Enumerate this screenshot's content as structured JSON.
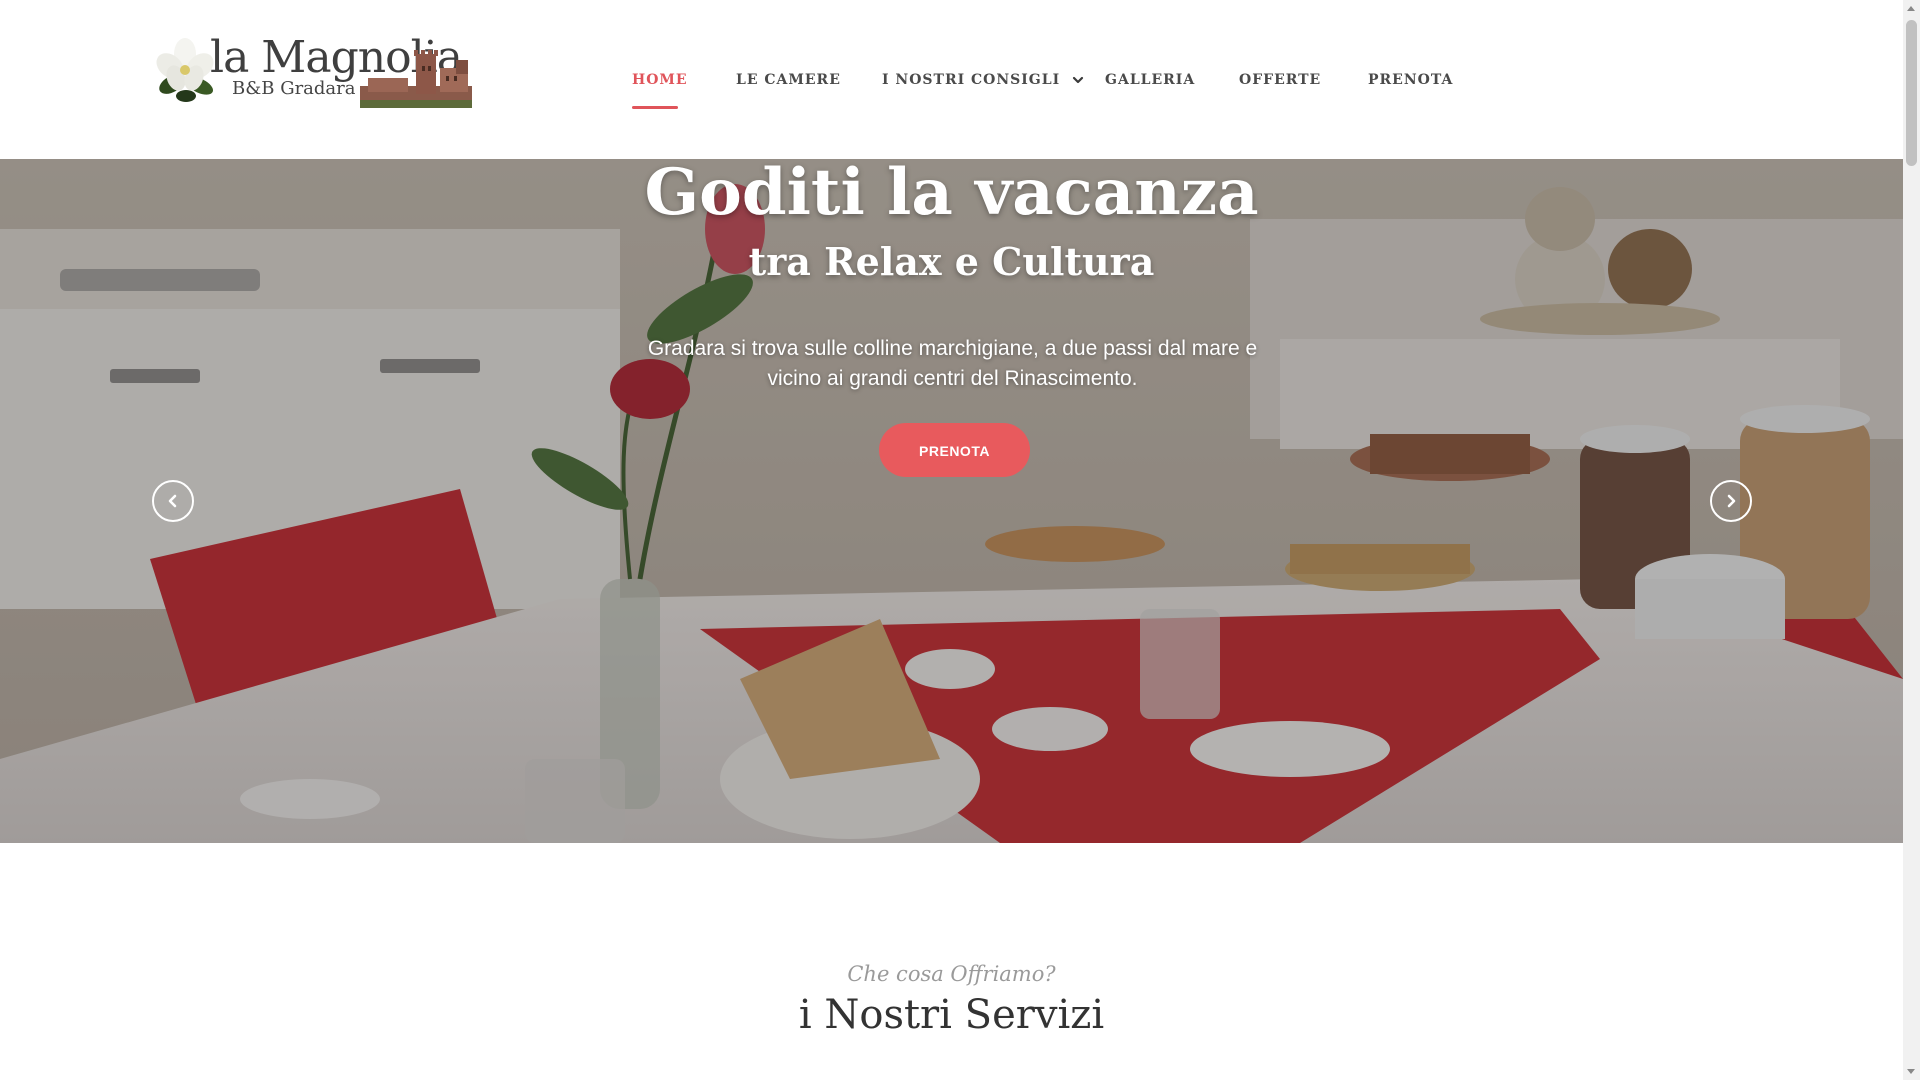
{
  "brand": {
    "name": "la Magnolia",
    "tagline": "B&B Gradara"
  },
  "nav": {
    "items": [
      {
        "label": "HOME",
        "active": true
      },
      {
        "label": "LE CAMERE",
        "active": false
      },
      {
        "label": "I NOSTRI CONSIGLI",
        "active": false,
        "has_dropdown": true
      },
      {
        "label": "GALLERIA",
        "active": false
      },
      {
        "label": "OFFERTE",
        "active": false
      },
      {
        "label": "PRENOTA",
        "active": false
      }
    ],
    "dropdown_icon": "chevron-down-icon"
  },
  "hero": {
    "title": "Goditi la vacanza",
    "subtitle": "tra Relax e Cultura",
    "text": "Gradara si trova sulle colline marchigiane, a due passi dal mare e vicino ai grandi centri del Rinascimento.",
    "button_label": "PRENOTA",
    "prev_icon": "chevron-left-icon",
    "next_icon": "chevron-right-icon"
  },
  "services": {
    "eyebrow": "Che cosa Offriamo?",
    "title": "i Nostri Servizi"
  },
  "colors": {
    "accent": "#e0545a",
    "button": "#e85a5d",
    "nav_text": "#4a4a4a",
    "heading": "#333333"
  }
}
